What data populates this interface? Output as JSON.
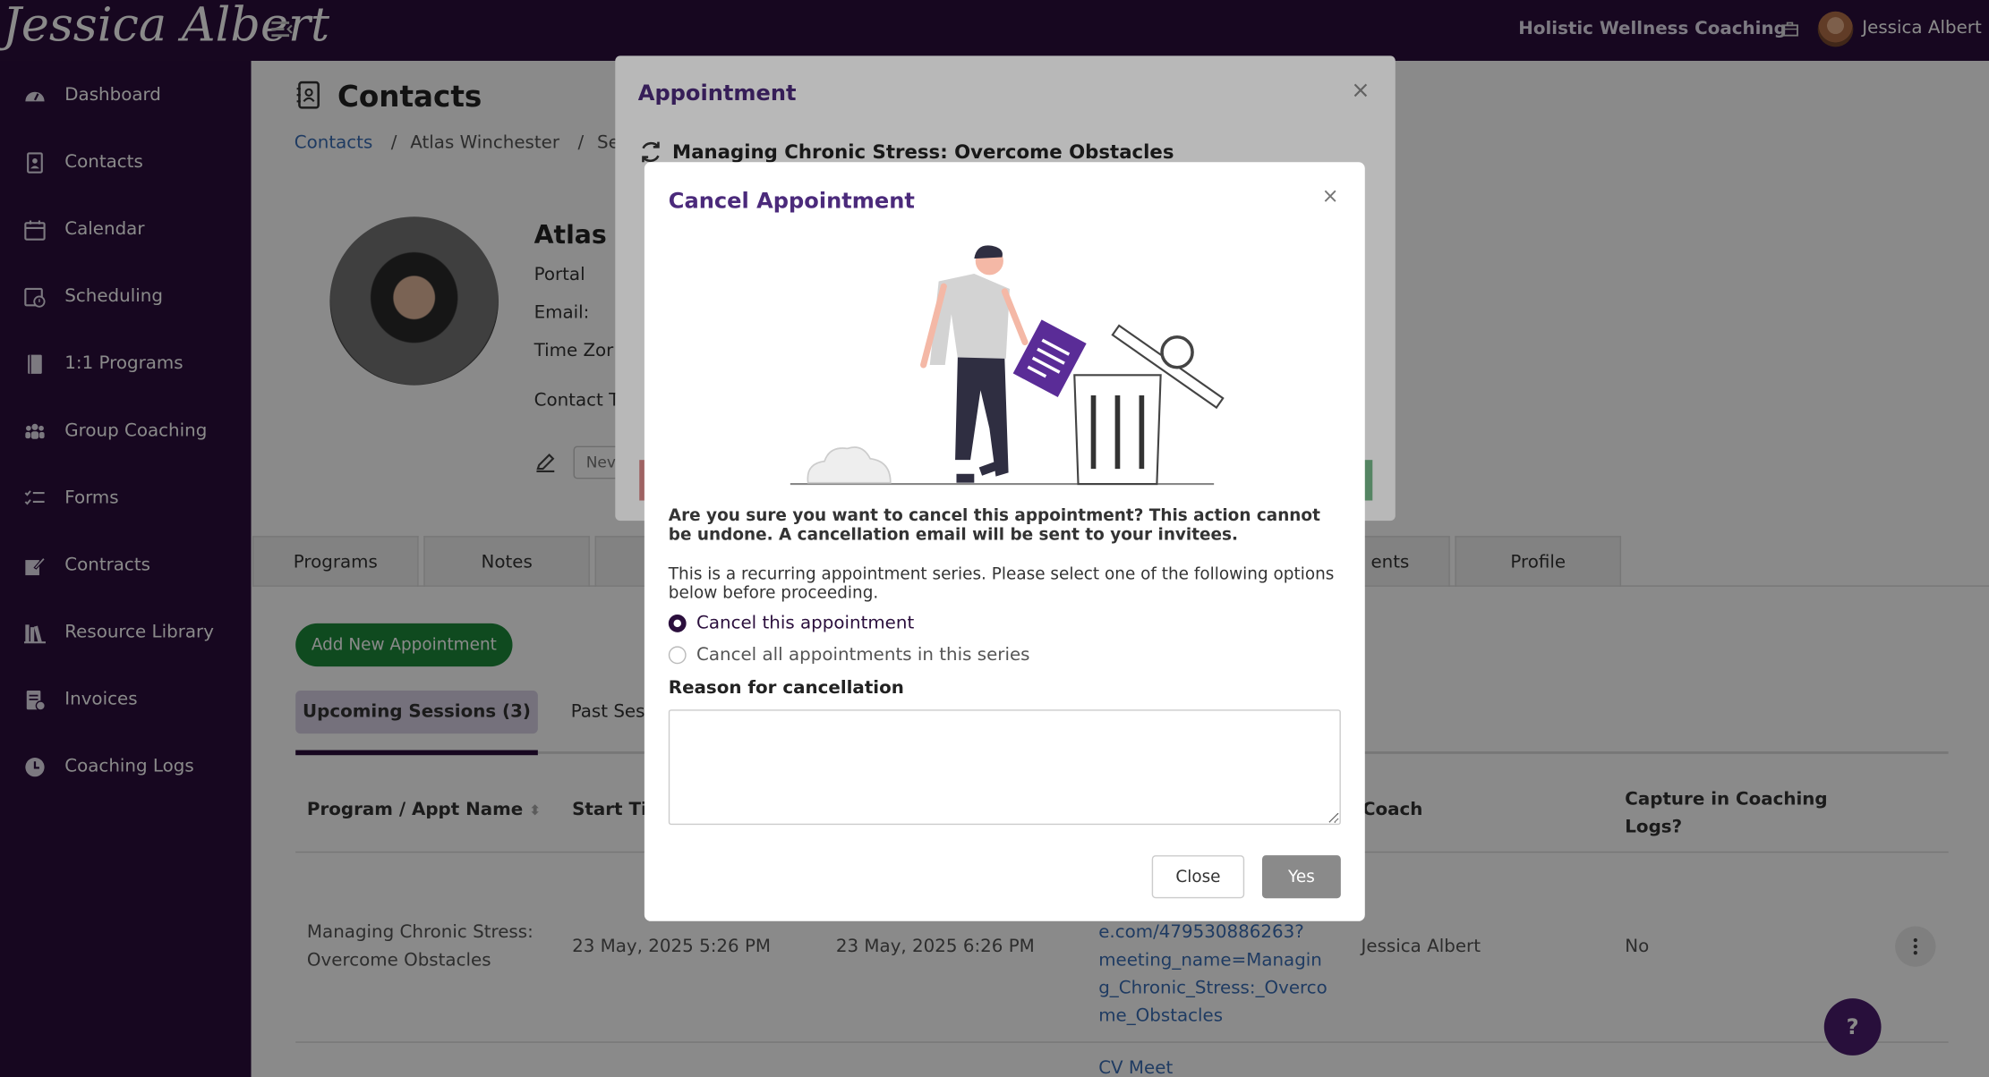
{
  "app": {
    "logo_text": "Jessica Albert",
    "org_name": "Holistic Wellness Coaching",
    "user_name": "Jessica Albert"
  },
  "sidebar": {
    "items": [
      {
        "label": "Dashboard",
        "icon": "dashboard-icon"
      },
      {
        "label": "Contacts",
        "icon": "contacts-icon"
      },
      {
        "label": "Calendar",
        "icon": "calendar-icon"
      },
      {
        "label": "Scheduling",
        "icon": "scheduling-icon"
      },
      {
        "label": "1:1 Programs",
        "icon": "book-icon"
      },
      {
        "label": "Group Coaching",
        "icon": "group-icon"
      },
      {
        "label": "Forms",
        "icon": "forms-icon"
      },
      {
        "label": "Contracts",
        "icon": "contract-icon"
      },
      {
        "label": "Resource Library",
        "icon": "library-icon"
      },
      {
        "label": "Invoices",
        "icon": "invoice-icon"
      },
      {
        "label": "Coaching Logs",
        "icon": "clock-icon"
      }
    ]
  },
  "page": {
    "title": "Contacts",
    "breadcrumb": {
      "root": "Contacts",
      "sep": "/",
      "contact": "Atlas Winchester",
      "tail": "Se"
    },
    "contact": {
      "name_partial": "Atlas W",
      "portal_label": "Portal",
      "email_label": "Email:",
      "timezone_label": "Time Zor",
      "contact_label": "Contact T",
      "new_chip": "Nev"
    },
    "tabs": [
      "Programs",
      "Notes",
      "",
      "ents",
      "Profile"
    ],
    "add_button": "Add New Appointment",
    "subtabs": {
      "upcoming": "Upcoming Sessions (3)",
      "past": "Past Ses"
    },
    "table": {
      "headers": {
        "program": "Program / Appt Name",
        "start": "Start Ti",
        "coach": "Coach",
        "capture": [
          "Capture in Coaching",
          "Logs?"
        ]
      },
      "row": {
        "program": [
          "Managing Chronic Stress:",
          "Overcome Obstacles"
        ],
        "start": "23 May, 2025 5:26 PM",
        "end": "23 May, 2025 6:26 PM",
        "link": [
          "e.com/479530886263?",
          "meeting_name=Managin",
          "g_Chronic_Stress:_Overco",
          "me_Obstacles"
        ],
        "coach": "Jessica Albert",
        "capture": "No"
      },
      "next_row_link": "CV Meet"
    },
    "help": "?"
  },
  "appointment_modal": {
    "title": "Appointment",
    "subject": "Managing Chronic Stress: Overcome Obstacles",
    "close": "×"
  },
  "cancel_modal": {
    "title": "Cancel Appointment",
    "close": "×",
    "warning": "Are you sure you want to cancel this appointment? This action cannot be undone. A cancellation email will be sent to your invitees.",
    "recurring_note": "This is a recurring appointment series. Please select one of the following options below before proceeding.",
    "options": [
      {
        "label": "Cancel this appointment",
        "selected": true
      },
      {
        "label": "Cancel all appointments in this series",
        "selected": false
      }
    ],
    "reason_label": "Reason for cancellation",
    "reason_value": "",
    "close_button": "Close",
    "yes_button": "Yes"
  },
  "colors": {
    "sidebar_bg": "#2b0f3d",
    "accent_purple": "#4b2a7b",
    "add_button_green": "#1c8a3b",
    "link_blue": "#3b6fb6",
    "yes_button_disabled": "#8a8a8a"
  }
}
